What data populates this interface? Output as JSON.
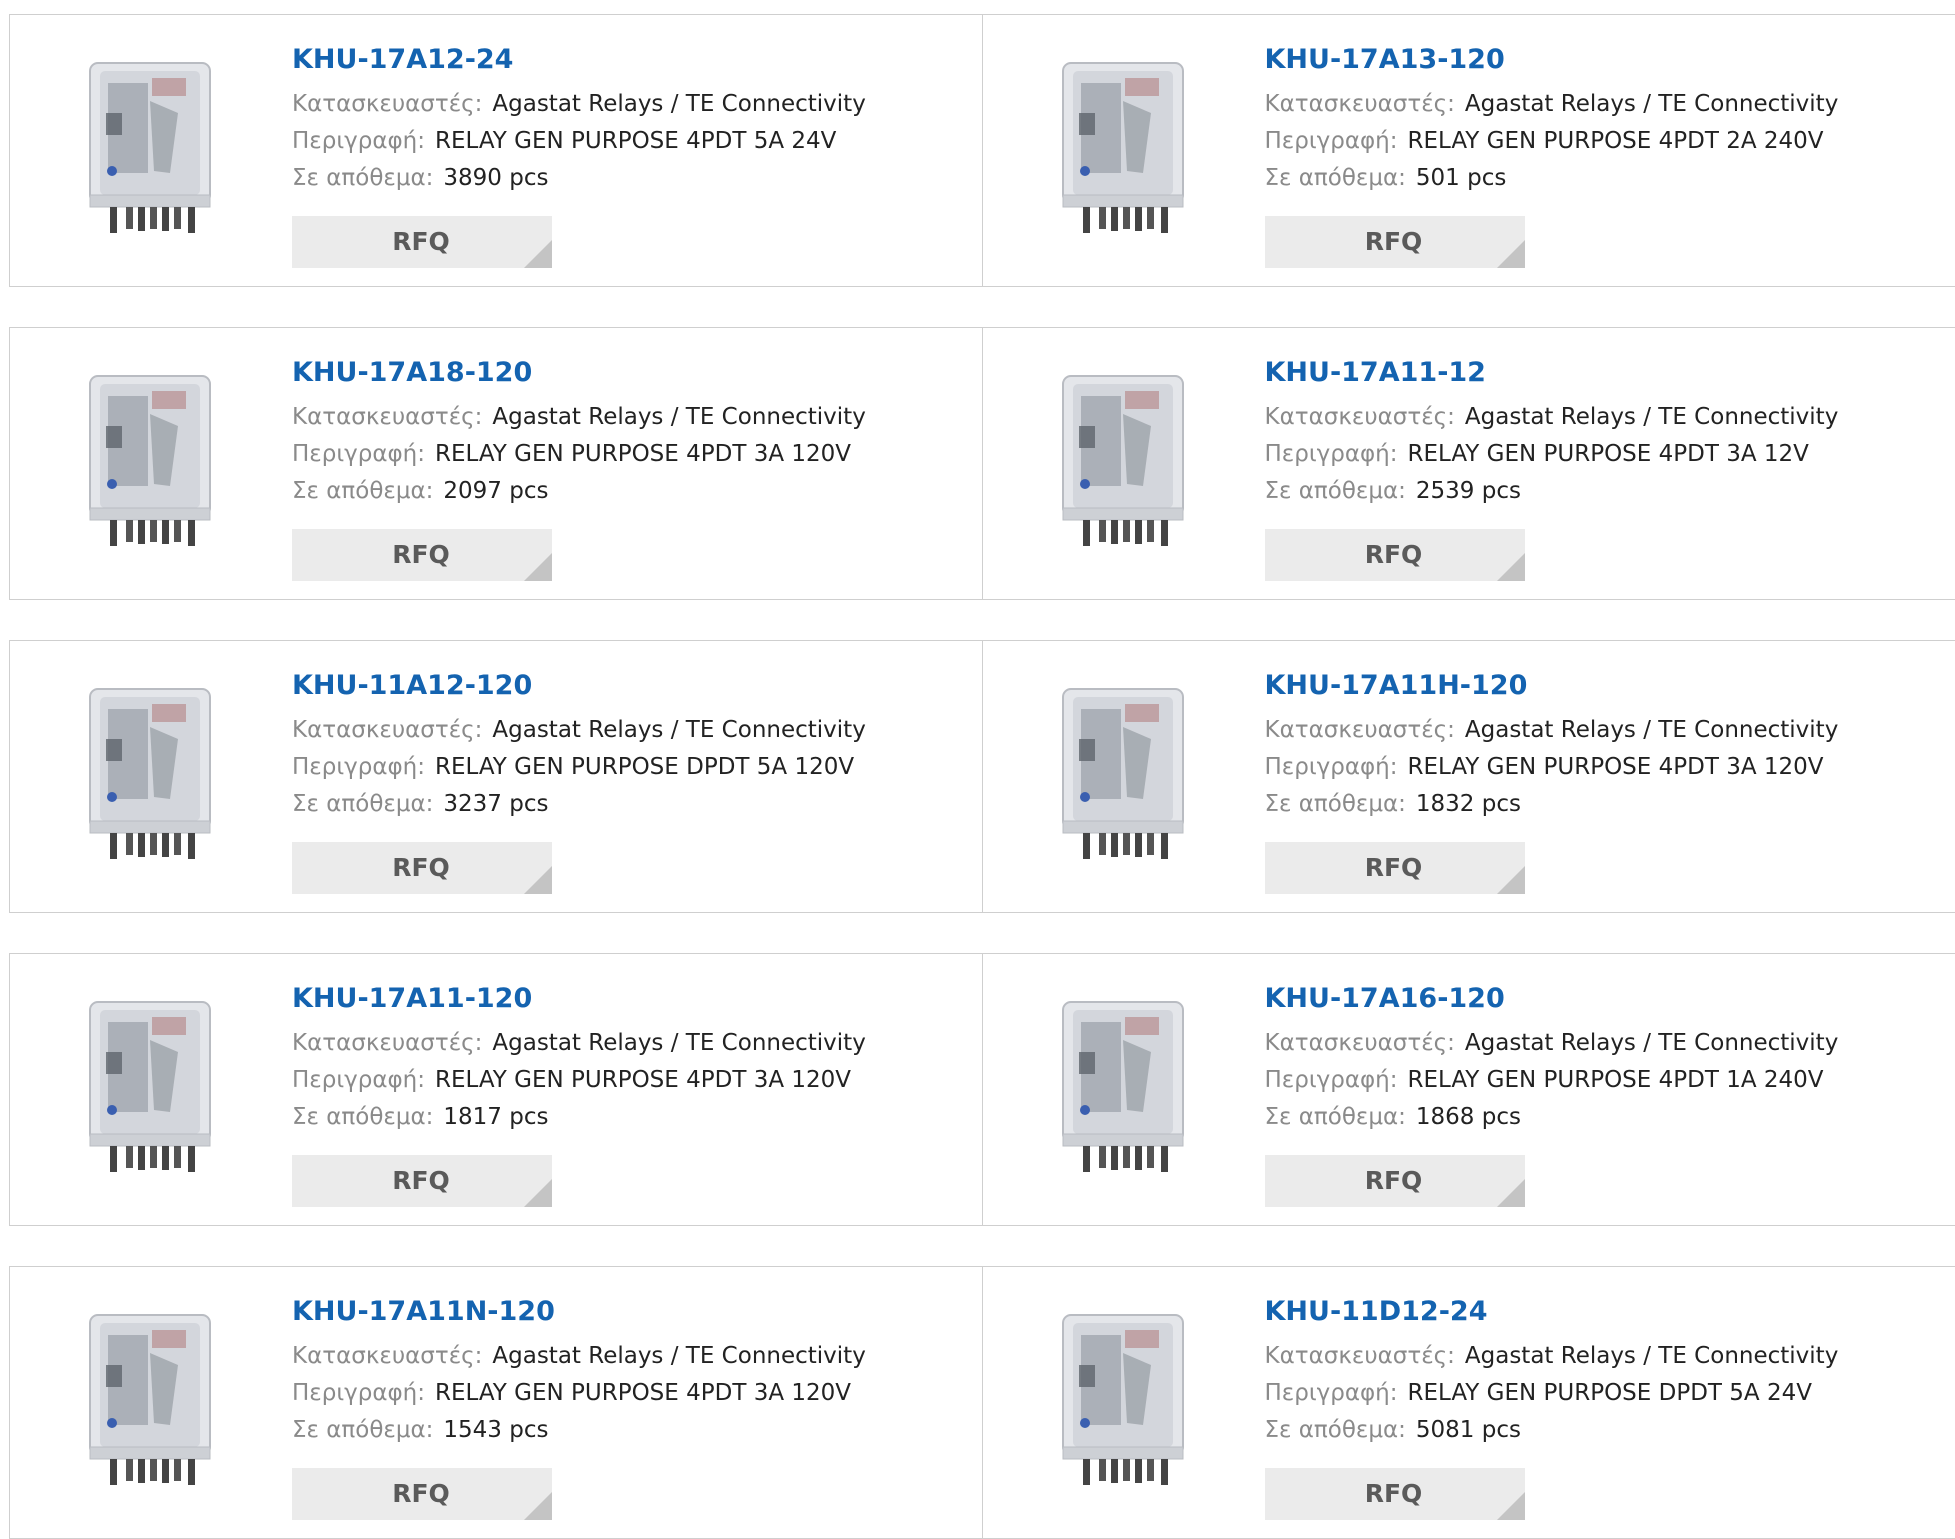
{
  "labels": {
    "manufacturer": "Κατασκευαστές:",
    "description": "Περιγραφή:",
    "stock": "Σε απόθεμα:",
    "rfq": "RFQ"
  },
  "colors": {
    "title": "#1463b0",
    "label": "#8a8a8a",
    "button_bg": "#ebebeb",
    "border": "#cfcfcf"
  },
  "image_icon": "relay-product-image",
  "products": [
    {
      "part": "KHU-17A12-24",
      "manufacturer": "Agastat Relays / TE Connectivity",
      "description": "RELAY GEN PURPOSE 4PDT 5A 24V",
      "stock": "3890 pcs"
    },
    {
      "part": "KHU-17A13-120",
      "manufacturer": "Agastat Relays / TE Connectivity",
      "description": "RELAY GEN PURPOSE 4PDT 2A 240V",
      "stock": "501 pcs"
    },
    {
      "part": "KHU-17A18-120",
      "manufacturer": "Agastat Relays / TE Connectivity",
      "description": "RELAY GEN PURPOSE 4PDT 3A 120V",
      "stock": "2097 pcs"
    },
    {
      "part": "KHU-17A11-12",
      "manufacturer": "Agastat Relays / TE Connectivity",
      "description": "RELAY GEN PURPOSE 4PDT 3A 12V",
      "stock": "2539 pcs"
    },
    {
      "part": "KHU-11A12-120",
      "manufacturer": "Agastat Relays / TE Connectivity",
      "description": "RELAY GEN PURPOSE DPDT 5A 120V",
      "stock": "3237 pcs"
    },
    {
      "part": "KHU-17A11H-120",
      "manufacturer": "Agastat Relays / TE Connectivity",
      "description": "RELAY GEN PURPOSE 4PDT 3A 120V",
      "stock": "1832 pcs"
    },
    {
      "part": "KHU-17A11-120",
      "manufacturer": "Agastat Relays / TE Connectivity",
      "description": "RELAY GEN PURPOSE 4PDT 3A 120V",
      "stock": "1817 pcs"
    },
    {
      "part": "KHU-17A16-120",
      "manufacturer": "Agastat Relays / TE Connectivity",
      "description": "RELAY GEN PURPOSE 4PDT 1A 240V",
      "stock": "1868 pcs"
    },
    {
      "part": "KHU-17A11N-120",
      "manufacturer": "Agastat Relays / TE Connectivity",
      "description": "RELAY GEN PURPOSE 4PDT 3A 120V",
      "stock": "1543 pcs"
    },
    {
      "part": "KHU-11D12-24",
      "manufacturer": "Agastat Relays / TE Connectivity",
      "description": "RELAY GEN PURPOSE DPDT 5A 24V",
      "stock": "5081 pcs"
    }
  ]
}
